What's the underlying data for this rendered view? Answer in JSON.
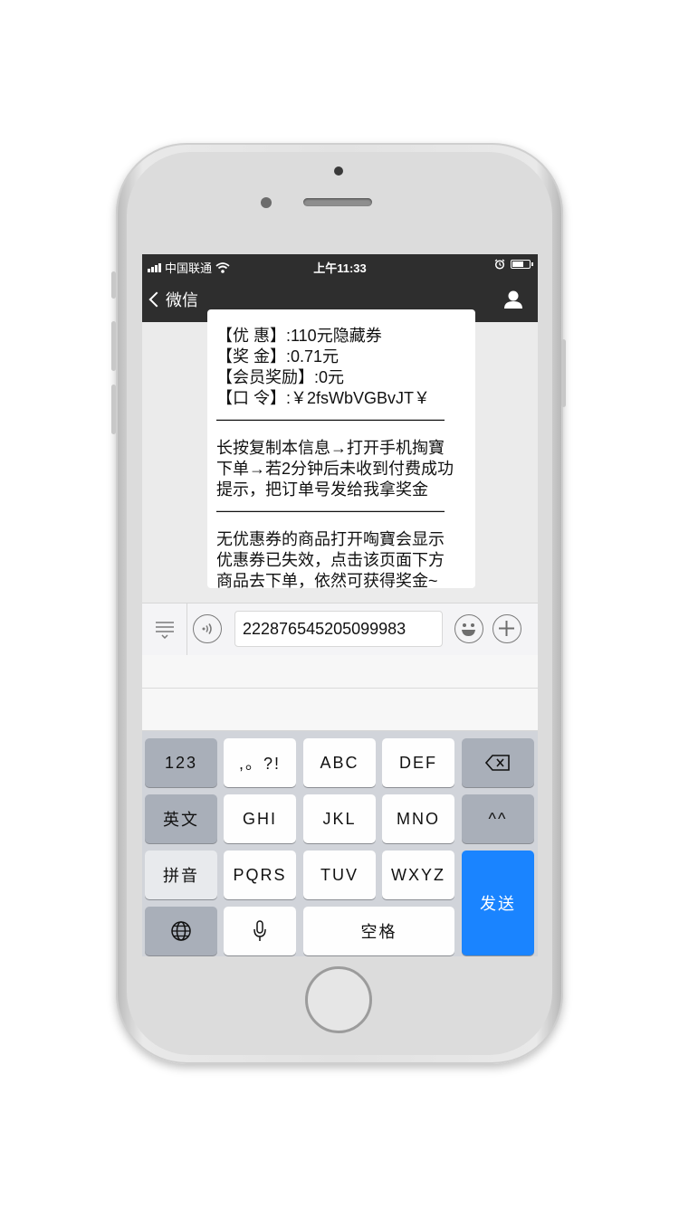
{
  "status_bar": {
    "carrier": "中国联通",
    "time": "上午11:33"
  },
  "nav": {
    "back_label": "微信"
  },
  "message": {
    "lines": [
      "【优 惠】:110元隐藏券",
      "【奖 金】:0.71元",
      "【会员奖励】:0元",
      "【口 令】:￥2fsWbVGBvJT￥",
      "——————————————",
      "长按复制本信息→打开手机掏寶",
      "下单→若2分钟后未收到付费成功",
      "提示，把订单号发给我拿奖金",
      "——————————————",
      "无优惠券的商品打开啕寶会显示",
      "优惠券已失效，点击该页面下方",
      "商品去下单，依然可获得奖金~"
    ]
  },
  "input": {
    "value": "222876545205099983"
  },
  "keyboard": {
    "row1": [
      "123",
      ",。?!",
      "ABC",
      "DEF"
    ],
    "row2": [
      "英文",
      "GHI",
      "JKL",
      "MNO",
      "^^"
    ],
    "row3": [
      "拼音",
      "PQRS",
      "TUV",
      "WXYZ"
    ],
    "send": "发送",
    "space": "空格"
  }
}
